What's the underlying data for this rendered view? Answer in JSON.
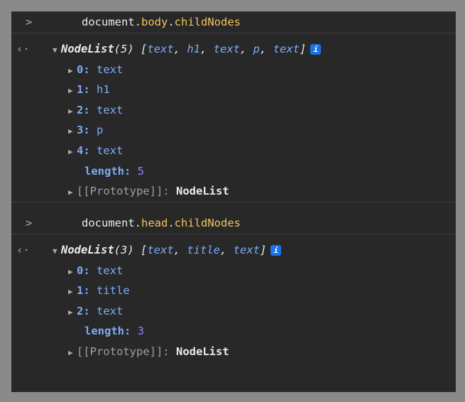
{
  "blocks": [
    {
      "command": {
        "object": "document",
        "prop": "body",
        "member": "childNodes"
      },
      "header": {
        "type": "NodeList",
        "count": "(5)",
        "preview": [
          "text",
          "h1",
          "text",
          "p",
          "text"
        ]
      },
      "items": [
        {
          "index": "0",
          "value": "text"
        },
        {
          "index": "1",
          "value": "h1"
        },
        {
          "index": "2",
          "value": "text"
        },
        {
          "index": "3",
          "value": "p"
        },
        {
          "index": "4",
          "value": "text"
        }
      ],
      "length_label": "length",
      "length_value": "5",
      "prototype_label": "[[Prototype]]",
      "prototype_value": "NodeList"
    },
    {
      "command": {
        "object": "document",
        "prop": "head",
        "member": "childNodes"
      },
      "header": {
        "type": "NodeList",
        "count": "(3)",
        "preview": [
          "text",
          "title",
          "text"
        ]
      },
      "items": [
        {
          "index": "0",
          "value": "text"
        },
        {
          "index": "1",
          "value": "title"
        },
        {
          "index": "2",
          "value": "text"
        }
      ],
      "length_label": "length",
      "length_value": "3",
      "prototype_label": "[[Prototype]]",
      "prototype_value": "NodeList"
    }
  ],
  "glyphs": {
    "prompt": ">",
    "return": "‹·",
    "info": "i",
    "expanded": "▼",
    "collapsed": "▶"
  },
  "colors": {
    "background": "#282828",
    "keyword": "#f2c55c",
    "key": "#7cacf8",
    "number": "#9980ff",
    "info_badge": "#1a73e8"
  }
}
